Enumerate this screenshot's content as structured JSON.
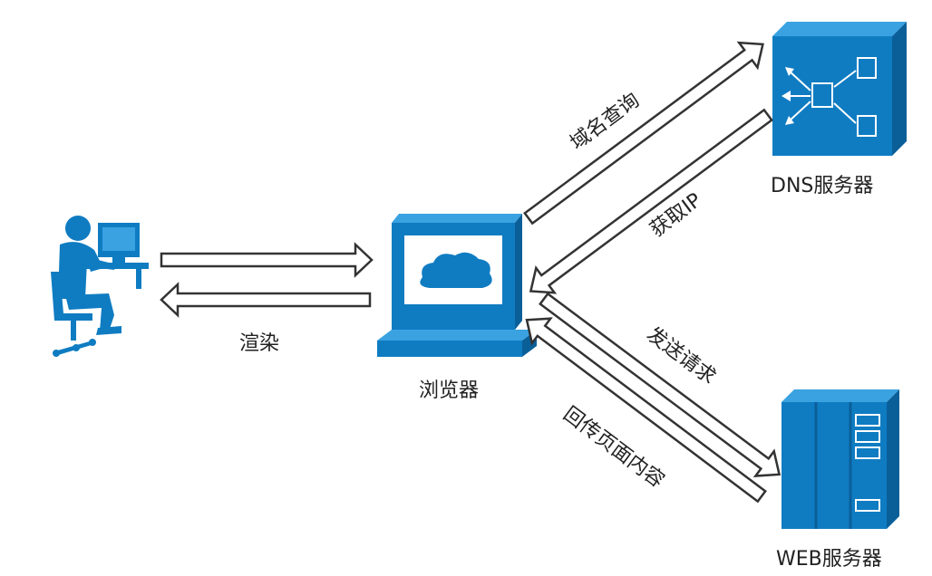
{
  "nodes": {
    "user": {
      "label": ""
    },
    "browser": {
      "label": "浏览器"
    },
    "dns": {
      "label": "DNS服务器"
    },
    "web": {
      "label": "WEB服务器"
    }
  },
  "edges": {
    "render": "渲染",
    "domain_query": "域名查询",
    "get_ip": "获取IP",
    "send_request": "发送请求",
    "return_content": "回传页面内容"
  },
  "colors": {
    "icon_fill": "#0f7cc2",
    "icon_dark": "#0a5f99",
    "icon_top": "#3aa2e0",
    "arrow_stroke": "#333333",
    "text": "#222222"
  }
}
